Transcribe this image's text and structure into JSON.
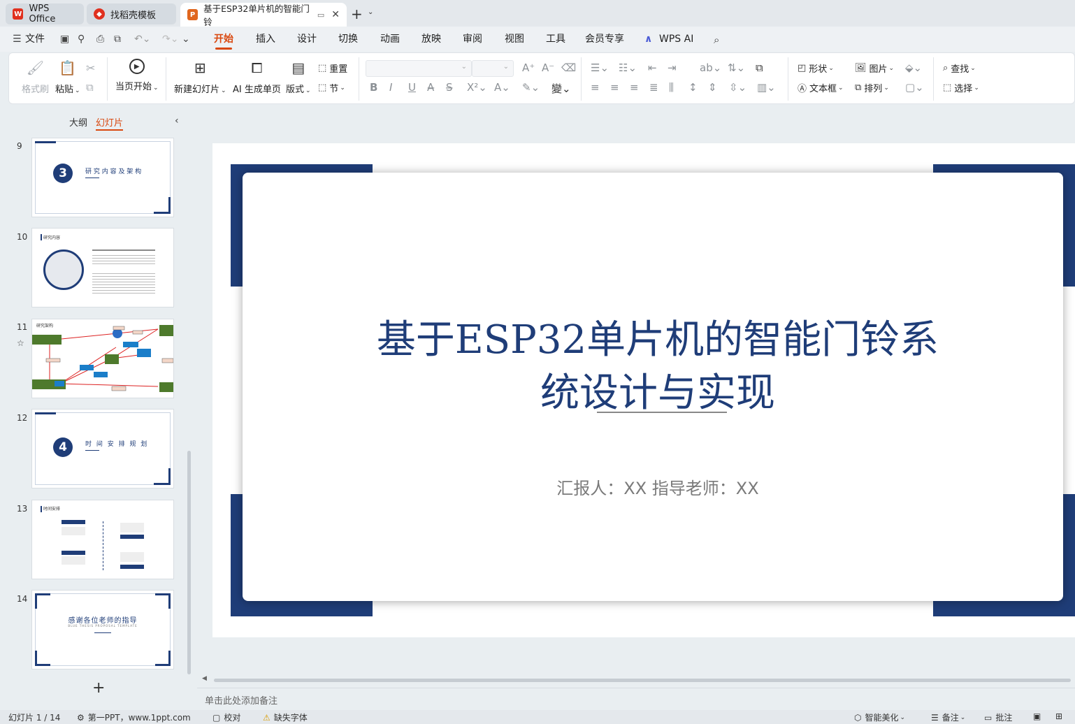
{
  "tabs": [
    {
      "label": "WPS Office",
      "logo": "W",
      "logo_color": "#e0301e"
    },
    {
      "label": "找稻壳模板",
      "logo": "稻",
      "logo_color": "#e0301e"
    },
    {
      "label": "基于ESP32单片机的智能门铃",
      "logo": "P",
      "logo_color": "#e0661e"
    }
  ],
  "menu": {
    "file": "文件",
    "items": [
      "开始",
      "插入",
      "设计",
      "切换",
      "动画",
      "放映",
      "审阅",
      "视图",
      "工具",
      "会员专享"
    ],
    "wps_ai": "WPS AI"
  },
  "ribbon": {
    "format_painter": "格式刷",
    "paste": "粘贴",
    "from_start": "当页开始",
    "new_slide": "新建幻灯片",
    "ai_single": "AI 生成单页",
    "layout": "版式",
    "reset": "重置",
    "section": "节",
    "shape": "形状",
    "picture": "图片",
    "textbox": "文本框",
    "arrange": "排列",
    "find": "查找",
    "select": "选择"
  },
  "left_panel": {
    "tab_outline": "大纲",
    "tab_slides": "幻灯片",
    "thumbs": [
      {
        "num": "9",
        "title": "研 究 内 容 及 架 构",
        "badge": "3"
      },
      {
        "num": "10",
        "title": "研究内容"
      },
      {
        "num": "11",
        "title": "研究架构"
      },
      {
        "num": "12",
        "title": "时 间 安 排 规 划",
        "badge": "4"
      },
      {
        "num": "13",
        "title": "时间安排"
      },
      {
        "num": "14",
        "title": "感谢各位老师的指导",
        "sub": "BLUE THESIS PROPOSAL TEMPLATE"
      }
    ]
  },
  "slide": {
    "title_line1": "基于ESP32单片机的智能门铃系",
    "title_line2": "统设计与实现",
    "subtitle": "汇报人：XX   指导老师：XX"
  },
  "notes_placeholder": "单击此处添加备注",
  "status": {
    "slide_counter": "幻灯片 1 / 14",
    "theme": "第一PPT，www.1ppt.com",
    "proofread": "校对",
    "missing_font": "缺失字体",
    "beautify": "智能美化",
    "notes": "备注",
    "comments": "批注"
  },
  "colors": {
    "accent": "#d9480f",
    "slide_blue": "#1f3d78"
  }
}
